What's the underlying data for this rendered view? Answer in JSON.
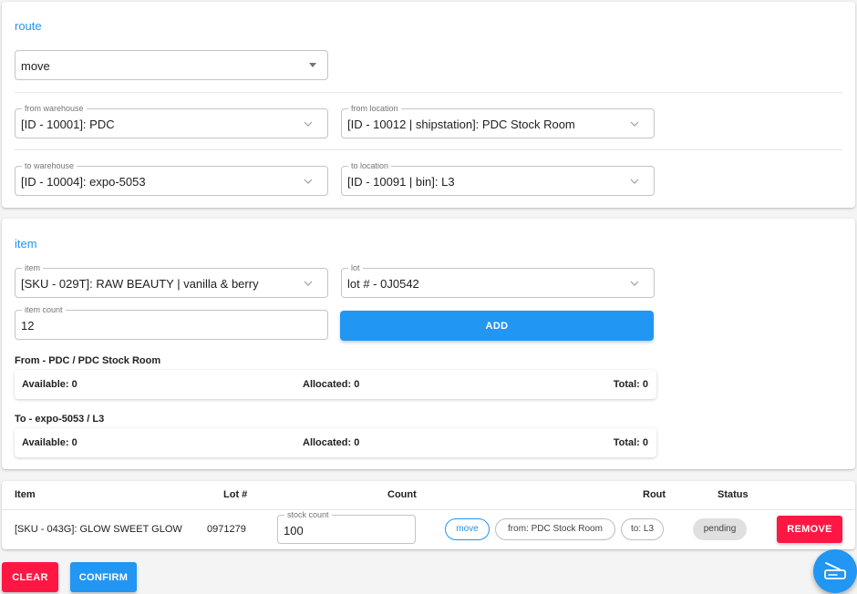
{
  "route": {
    "title": "route",
    "type_value": "move",
    "from_warehouse": {
      "label": "from warehouse",
      "value": "[ID - 10001]: PDC"
    },
    "from_location": {
      "label": "from location",
      "value": "[ID - 10012 | shipstation]: PDC Stock Room"
    },
    "to_warehouse": {
      "label": "to warehouse",
      "value": "[ID - 10004]: expo-5053"
    },
    "to_location": {
      "label": "to location",
      "value": "[ID - 10091 | bin]: L3"
    }
  },
  "item_section": {
    "title": "item",
    "item": {
      "label": "item",
      "value": "[SKU - 029T]: RAW BEAUTY | vanilla & berry"
    },
    "lot": {
      "label": "lot",
      "value": "lot # - 0J0542"
    },
    "item_count": {
      "label": "item count",
      "value": "12"
    },
    "add_label": "ADD",
    "from_stock": {
      "heading": "From - PDC / PDC Stock Room",
      "available": "Available: 0",
      "allocated": "Allocated: 0",
      "total": "Total: 0"
    },
    "to_stock": {
      "heading": "To - expo-5053 / L3",
      "available": "Available: 0",
      "allocated": "Allocated: 0",
      "total": "Total: 0"
    }
  },
  "table": {
    "headers": {
      "item": "Item",
      "lot": "Lot #",
      "count": "Count",
      "route": "Rout",
      "status": "Status"
    },
    "rows": [
      {
        "item": "[SKU - 043G]: GLOW SWEET GLOW",
        "lot": "0971279",
        "count_label": "stock count",
        "count": "100",
        "route_type": "move",
        "from": "from: PDC Stock Room",
        "to": "to: L3",
        "status": "pending",
        "remove_label": "REMOVE"
      }
    ]
  },
  "footer": {
    "clear_label": "CLEAR",
    "confirm_label": "CONFIRM"
  },
  "icons": {
    "fab": "scanner-icon",
    "select_arrow": "chevron-down-icon"
  },
  "colors": {
    "primary": "#2196f3",
    "danger": "#ff1744",
    "chip_grey": "#e0e0e0"
  }
}
